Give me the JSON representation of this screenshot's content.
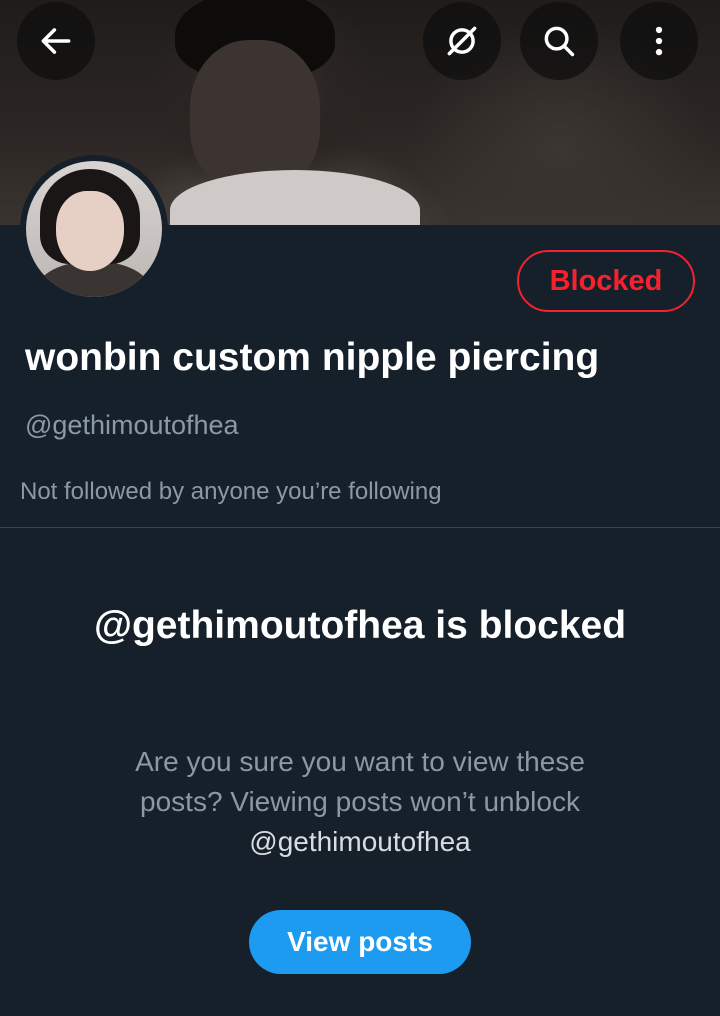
{
  "header": {
    "back_icon": "arrow-left-icon",
    "grok_icon": "grok-icon",
    "search_icon": "search-icon",
    "more_icon": "more-vertical-icon"
  },
  "profile": {
    "display_name": "wonbin custom nipple piercing",
    "handle": "@gethimoutofhea",
    "followers_note": "Not followed by anyone you’re following",
    "blocked_label": "Blocked"
  },
  "block_notice": {
    "title": "@gethimoutofhea is blocked",
    "desc_text": "Are you sure you want to view these posts? Viewing posts won’t unblock",
    "desc_handle": "@gethimoutofhea",
    "button_label": "View posts"
  },
  "colors": {
    "background": "#15202b",
    "blocked_red": "#f4212e",
    "accent_blue": "#1d9bf0",
    "secondary_text": "#8b98a5"
  }
}
